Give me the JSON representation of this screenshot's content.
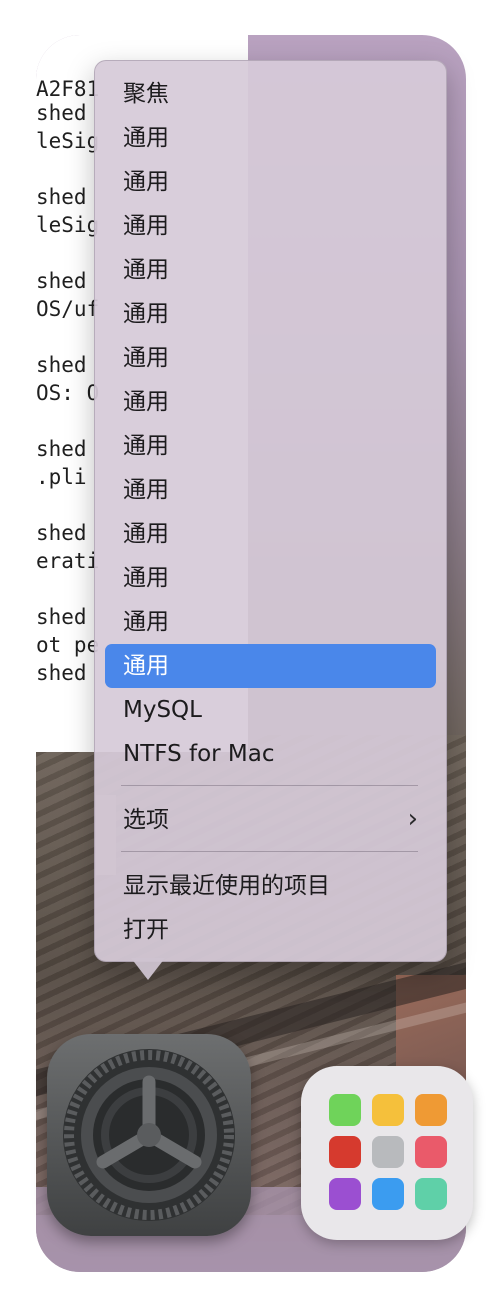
{
  "terminal": {
    "lines": [
      "A2F81",
      "shed",
      "leSig",
      "",
      "shed",
      "leSig",
      "",
      "shed",
      "OS/uf",
      "",
      "shed",
      "OS: O",
      "",
      "shed",
      ".pli",
      "",
      "shed",
      "erati",
      "",
      "shed",
      "ot pe",
      "shed"
    ]
  },
  "context_menu": {
    "items": [
      {
        "label": "聚焦"
      },
      {
        "label": "通用"
      },
      {
        "label": "通用"
      },
      {
        "label": "通用"
      },
      {
        "label": "通用"
      },
      {
        "label": "通用"
      },
      {
        "label": "通用"
      },
      {
        "label": "通用"
      },
      {
        "label": "通用"
      },
      {
        "label": "通用"
      },
      {
        "label": "通用"
      },
      {
        "label": "通用"
      },
      {
        "label": "通用"
      },
      {
        "label": "通用",
        "selected": true
      },
      {
        "label": "MySQL"
      },
      {
        "label": "NTFS for Mac"
      }
    ],
    "options_label": "选项",
    "show_recent_label": "显示最近使用的项目",
    "open_label": "打开",
    "selected_color": "#4a87ea"
  },
  "dock": {
    "system_preferences_icon": "gear-icon",
    "launchpad_icon": "grid-icon",
    "launchpad_colors": [
      "#6fd35a",
      "#f5c03b",
      "#ef9a34",
      "#d63a2e",
      "#b8babd",
      "#ea5a6a",
      "#9b4fd1",
      "#3b9cf0",
      "#5fd0a8"
    ]
  }
}
